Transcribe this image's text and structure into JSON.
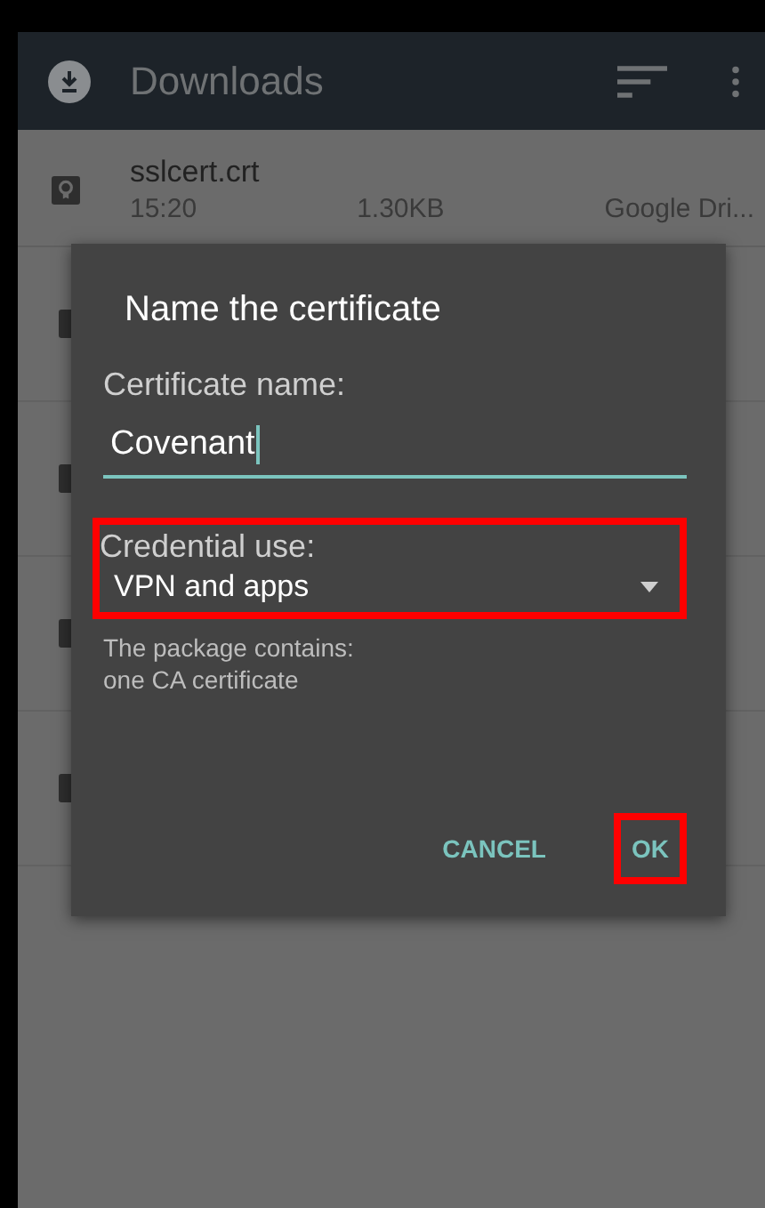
{
  "app_bar": {
    "title": "Downloads"
  },
  "files": [
    {
      "name": "sslcert.crt",
      "time": "15:20",
      "size": "1.30KB",
      "source": "Google Dri..."
    }
  ],
  "dialog": {
    "title": "Name the certificate",
    "name_label": "Certificate name:",
    "name_value": "Covenant",
    "use_label": "Credential use:",
    "use_value": "VPN and apps",
    "use_highlighted": true,
    "info": [
      "The package contains:",
      "one CA certificate"
    ],
    "buttons": [
      {
        "label": "CANCEL",
        "highlighted": false
      },
      {
        "label": "OK",
        "highlighted": true
      }
    ]
  }
}
